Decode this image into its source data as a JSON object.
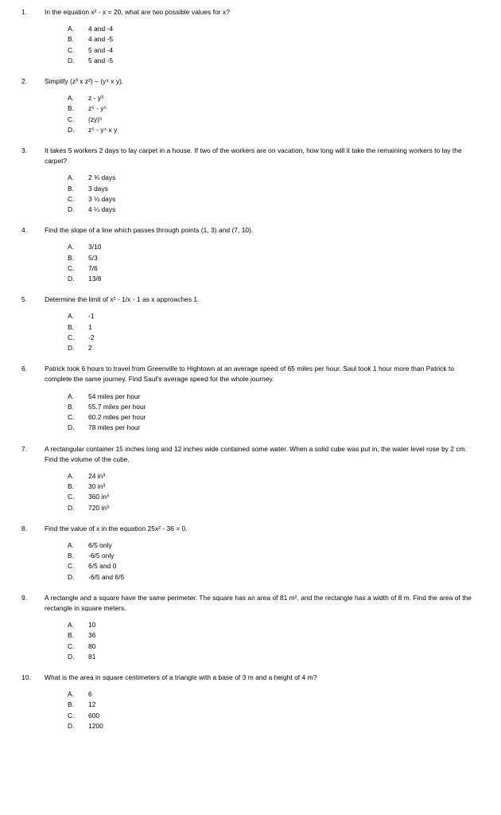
{
  "document": {
    "type": "multiple-choice-math-worksheet",
    "page_background": "#ffffff",
    "text_color": "#000000"
  },
  "questions": [
    {
      "number": "1.",
      "text": "In the equation x² - x = 20, what are two possible values for x?",
      "options": [
        {
          "letter": "A.",
          "text": "4 and -4"
        },
        {
          "letter": "B.",
          "text": "4 and -5"
        },
        {
          "letter": "C.",
          "text": "5 and -4"
        },
        {
          "letter": "D.",
          "text": "5 and -5"
        }
      ]
    },
    {
      "number": "2.",
      "text": "Simplify (z³ x z²) – (y⁴ x y).",
      "options": [
        {
          "letter": "A.",
          "text": "z - y³"
        },
        {
          "letter": "B.",
          "text": "z⁵ - y⁵"
        },
        {
          "letter": "C.",
          "text": "(zy)⁵"
        },
        {
          "letter": "D.",
          "text": "z⁵ - y⁴ x y"
        }
      ]
    },
    {
      "number": "3.",
      "text": "It takes 5 workers 2 days to lay carpet in a house. If two of the workers are on vacation, how long will it take the remaining workers to lay the carpet?",
      "options": [
        {
          "letter": "A.",
          "text": "2 ¾ days"
        },
        {
          "letter": "B.",
          "text": "3 days"
        },
        {
          "letter": "C.",
          "text": "3 ⅓ days"
        },
        {
          "letter": "D.",
          "text": "4 ¼ days"
        }
      ]
    },
    {
      "number": "4.",
      "text": "Find the slope of a line which passes through points (1, 3) and (7, 10).",
      "options": [
        {
          "letter": "A.",
          "text": "3/10"
        },
        {
          "letter": "B.",
          "text": "5/3"
        },
        {
          "letter": "C.",
          "text": "7/6"
        },
        {
          "letter": "D.",
          "text": "13/8"
        }
      ]
    },
    {
      "number": "5.",
      "text": "Determine the limit of x² - 1/x - 1 as x approaches 1.",
      "options": [
        {
          "letter": "A.",
          "text": "-1"
        },
        {
          "letter": "B.",
          "text": "1"
        },
        {
          "letter": "C.",
          "text": "-2"
        },
        {
          "letter": "D.",
          "text": "2"
        }
      ]
    },
    {
      "number": "6.",
      "text": "Patrick took 6 hours to travel from Greenville to Hightown at an average speed of 65 miles per hour.  Saul took 1 hour more than Patrick to complete the same journey.  Find Saul’s average speed for the whole journey.",
      "options": [
        {
          "letter": "A.",
          "text": "54 miles per hour"
        },
        {
          "letter": "B.",
          "text": "55.7 miles per hour"
        },
        {
          "letter": "C.",
          "text": "60.2 miles per hour"
        },
        {
          "letter": "D.",
          "text": "78 miles per hour"
        }
      ]
    },
    {
      "number": "7.",
      "text": "A rectangular container 15 inches long and 12 inches wide contained some water.  When a solid cube was put in, the water level rose by 2 cm.  Find the volume of the cube.",
      "options": [
        {
          "letter": "A.",
          "text": "24 in³"
        },
        {
          "letter": "B.",
          "text": "30 in³"
        },
        {
          "letter": "C.",
          "text": "360 in³"
        },
        {
          "letter": "D.",
          "text": "720 in³"
        }
      ]
    },
    {
      "number": "8.",
      "text": "Find the value of x in the equation 25x² - 36 = 0.",
      "options": [
        {
          "letter": "A.",
          "text": "6/5 only"
        },
        {
          "letter": "B.",
          "text": "-6/5 only"
        },
        {
          "letter": "C.",
          "text": "6/5 and 0"
        },
        {
          "letter": "D.",
          "text": "-6/5 and 6/5"
        }
      ]
    },
    {
      "number": "9.",
      "text": "A rectangle and a square have the same perimeter. The square has an area of 81 m², and the rectangle has a width of 8 m. Find the area of the rectangle in square meters.",
      "options": [
        {
          "letter": "A.",
          "text": "10"
        },
        {
          "letter": "B.",
          "text": "36"
        },
        {
          "letter": "C.",
          "text": "80"
        },
        {
          "letter": "D.",
          "text": "81"
        }
      ]
    },
    {
      "number": "10.",
      "text": "What is the area in square centimeters of a triangle with a base of 3 m and a height of 4 m?",
      "options": [
        {
          "letter": "A.",
          "text": "6"
        },
        {
          "letter": "B.",
          "text": "12"
        },
        {
          "letter": "C.",
          "text": "600"
        },
        {
          "letter": "D.",
          "text": "1200"
        }
      ]
    }
  ]
}
